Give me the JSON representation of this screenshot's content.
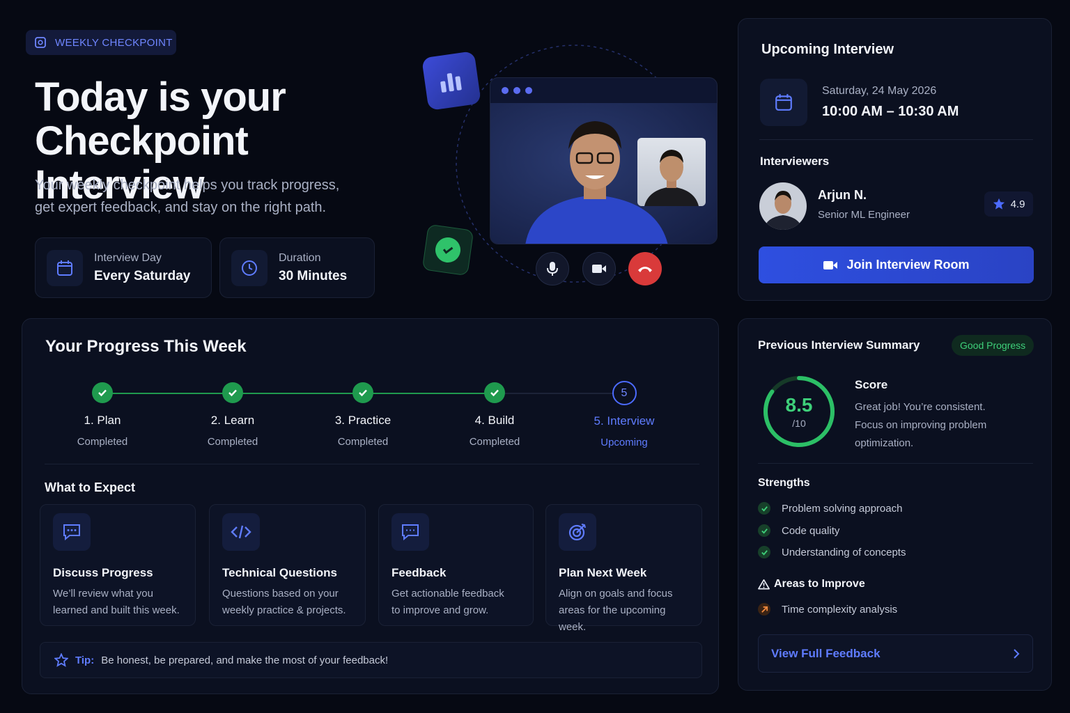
{
  "hero": {
    "badge": "WEEKLY CHECKPOINT",
    "title_line1": "Today is your",
    "title_line2": "Checkpoint Interview",
    "subtitle_line1": "Your weekly checkpoint helps you track progress,",
    "subtitle_line2": "get expert feedback, and stay on the right path.",
    "interview_day_label": "Interview Day",
    "interview_day_value": "Every Saturday",
    "duration_label": "Duration",
    "duration_value": "30 Minutes"
  },
  "upcoming": {
    "title": "Upcoming Interview",
    "date": "Saturday, 24 May 2026",
    "time": "10:00 AM – 10:30 AM",
    "interviewers_label": "Interviewers",
    "interviewer_name": "Arjun N.",
    "interviewer_role": "Senior ML Engineer",
    "rating": "4.9",
    "join_button": "Join Interview Room"
  },
  "progress": {
    "title": "Your Progress This Week",
    "steps": [
      {
        "title": "1. Plan",
        "status": "Completed"
      },
      {
        "title": "2. Learn",
        "status": "Completed"
      },
      {
        "title": "3. Practice",
        "status": "Completed"
      },
      {
        "title": "4. Build",
        "status": "Completed"
      },
      {
        "title": "5. Interview",
        "status": "Upcoming",
        "number": "5"
      }
    ],
    "expect_title": "What to Expect",
    "expect": [
      {
        "title": "Discuss Progress",
        "desc1": "We’ll review what you",
        "desc2": "learned and built this week."
      },
      {
        "title": "Technical Questions",
        "desc1": "Questions based on your",
        "desc2": "weekly practice & projects."
      },
      {
        "title": "Feedback",
        "desc1": "Get actionable feedback",
        "desc2": "to improve and grow."
      },
      {
        "title": "Plan Next Week",
        "desc1": "Align on goals and focus",
        "desc2": "areas for the upcoming week."
      }
    ],
    "tip_label": "Tip:",
    "tip_text": "Be honest, be prepared, and make the most of your feedback!"
  },
  "summary": {
    "title": "Previous Interview Summary",
    "badge": "Good Progress",
    "score": "8.5",
    "score_max": "/10",
    "score_fraction": 0.85,
    "score_label": "Score",
    "score_desc1": "Great job! You’re consistent.",
    "score_desc2": "Focus on improving problem",
    "score_desc3": "optimization.",
    "strengths_title": "Strengths",
    "strengths": [
      "Problem solving approach",
      "Code quality",
      "Understanding of concepts"
    ],
    "improve_title": "Areas to Improve",
    "improve": [
      "Time complexity analysis"
    ],
    "view_button": "View Full Feedback"
  },
  "colors": {
    "accent": "#3b5bff",
    "success": "#22a757",
    "danger": "#e23b3b",
    "background": "#060913"
  }
}
